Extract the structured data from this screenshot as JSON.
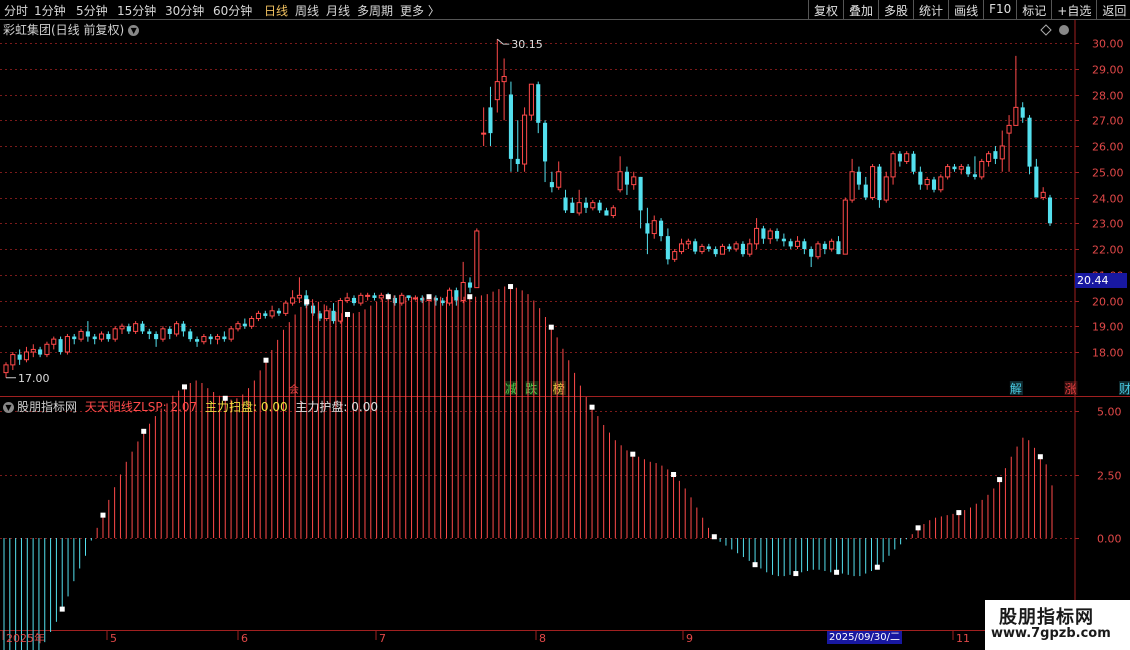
{
  "toolbar": {
    "periods": [
      "分时",
      "1分钟",
      "5分钟",
      "15分钟",
      "30分钟",
      "60分钟",
      "日线",
      "周线",
      "月线",
      "多周期",
      "更多 〉"
    ],
    "active_period": "日线",
    "buttons": [
      "复权",
      "叠加",
      "多股",
      "统计",
      "画线",
      "F10",
      "标记",
      "+自选",
      "返回"
    ]
  },
  "main_title": "彩虹集团(日线 前复权)",
  "price_tag": "20.44",
  "high_label": "30.15",
  "low_label": "17.00",
  "event_markers": [
    {
      "label": "减",
      "color": "#49c949"
    },
    {
      "label": "跌",
      "color": "#49c949"
    },
    {
      "label": "榜",
      "color": "#e0c040"
    },
    {
      "label": "解",
      "color": "#48c8e0"
    },
    {
      "label": "涨",
      "color": "#e04040"
    },
    {
      "label": "财",
      "color": "#48c8e0"
    }
  ],
  "small_marker": "会",
  "indicator_title": {
    "name": "股朋指标网",
    "line1": "天天阳线ZLSP: 2.07",
    "line2": "主力扫盘: 0.00",
    "line3": "主力护盘: 0.00"
  },
  "x_axis_labels": [
    "2025年",
    "5",
    "6",
    "7",
    "8",
    "9",
    "11"
  ],
  "date_tag": "2025/09/30/二",
  "watermark": {
    "line1": "股朋指标网",
    "line2": "www.7gpzb.com"
  },
  "colors": {
    "up": "#ff4a4a",
    "down": "#54e0ee",
    "grid": "#7a1a1a",
    "axis": "#a02020"
  },
  "chart_data": [
    {
      "type": "candlestick",
      "yticks": [
        "18.00",
        "19.00",
        "20.00",
        "21.00",
        "22.00",
        "23.00",
        "24.00",
        "25.00",
        "26.00",
        "27.00",
        "28.00",
        "29.00",
        "30.00"
      ],
      "ylim": [
        17.0,
        30.15
      ],
      "candles": [
        [
          17.2,
          17.5,
          17.0,
          17.6
        ],
        [
          17.5,
          17.9,
          17.3,
          18.0
        ],
        [
          17.9,
          17.7,
          17.5,
          18.1
        ],
        [
          17.7,
          18.0,
          17.6,
          18.2
        ],
        [
          18.0,
          18.1,
          17.8,
          18.3
        ],
        [
          18.1,
          17.9,
          17.8,
          18.2
        ],
        [
          17.9,
          18.3,
          17.8,
          18.4
        ],
        [
          18.3,
          18.5,
          18.1,
          18.6
        ],
        [
          18.5,
          18.0,
          17.9,
          18.6
        ],
        [
          18.0,
          18.6,
          17.9,
          18.7
        ],
        [
          18.6,
          18.5,
          18.3,
          18.7
        ],
        [
          18.5,
          18.8,
          18.4,
          18.9
        ],
        [
          18.8,
          18.6,
          18.4,
          19.2
        ],
        [
          18.6,
          18.5,
          18.3,
          18.7
        ],
        [
          18.5,
          18.7,
          18.4,
          18.8
        ],
        [
          18.7,
          18.5,
          18.4,
          18.8
        ],
        [
          18.5,
          18.9,
          18.4,
          19.0
        ],
        [
          18.9,
          19.0,
          18.7,
          19.1
        ],
        [
          19.0,
          18.8,
          18.7,
          19.1
        ],
        [
          18.8,
          19.1,
          18.7,
          19.2
        ],
        [
          19.1,
          18.8,
          18.7,
          19.2
        ],
        [
          18.8,
          18.7,
          18.5,
          18.9
        ],
        [
          18.7,
          18.5,
          18.2,
          18.8
        ],
        [
          18.5,
          18.9,
          18.4,
          19.0
        ],
        [
          18.9,
          18.7,
          18.5,
          19.0
        ],
        [
          18.7,
          19.1,
          18.6,
          19.2
        ],
        [
          19.1,
          18.8,
          18.6,
          19.2
        ],
        [
          18.8,
          18.5,
          18.4,
          18.9
        ],
        [
          18.5,
          18.4,
          18.2,
          18.6
        ],
        [
          18.4,
          18.6,
          18.3,
          18.7
        ],
        [
          18.6,
          18.5,
          18.3,
          18.7
        ],
        [
          18.5,
          18.6,
          18.3,
          18.7
        ],
        [
          18.6,
          18.5,
          18.4,
          18.8
        ],
        [
          18.5,
          18.9,
          18.4,
          19.0
        ],
        [
          18.9,
          19.1,
          18.8,
          19.2
        ],
        [
          19.1,
          19.0,
          18.9,
          19.3
        ],
        [
          19.0,
          19.3,
          18.9,
          19.4
        ],
        [
          19.3,
          19.5,
          19.2,
          19.6
        ],
        [
          19.5,
          19.4,
          19.3,
          19.6
        ],
        [
          19.4,
          19.6,
          19.3,
          19.8
        ],
        [
          19.6,
          19.5,
          19.4,
          19.7
        ],
        [
          19.5,
          19.9,
          19.4,
          20.0
        ],
        [
          19.9,
          20.1,
          19.8,
          20.4
        ],
        [
          20.1,
          20.2,
          19.9,
          20.9
        ],
        [
          20.2,
          19.8,
          19.7,
          20.4
        ],
        [
          19.8,
          19.5,
          19.4,
          19.9
        ],
        [
          19.5,
          19.3,
          19.2,
          19.6
        ],
        [
          19.3,
          19.6,
          19.2,
          19.8
        ],
        [
          19.6,
          19.2,
          19.1,
          19.9
        ],
        [
          19.2,
          20.0,
          19.1,
          20.1
        ],
        [
          20.0,
          20.1,
          19.9,
          20.3
        ],
        [
          20.1,
          19.9,
          19.8,
          20.2
        ],
        [
          19.9,
          20.2,
          19.8,
          20.3
        ],
        [
          20.2,
          20.2,
          20.0,
          20.3
        ],
        [
          20.2,
          20.1,
          20.0,
          20.3
        ],
        [
          20.1,
          20.2,
          20.0,
          20.3
        ],
        [
          20.2,
          20.1,
          20.0,
          20.3
        ],
        [
          20.1,
          19.9,
          19.8,
          20.2
        ],
        [
          19.9,
          20.2,
          19.8,
          20.3
        ],
        [
          20.2,
          20.1,
          20.0,
          20.2
        ],
        [
          20.1,
          20.1,
          20.0,
          20.2
        ],
        [
          20.1,
          20.0,
          19.9,
          20.2
        ],
        [
          20.0,
          20.1,
          19.8,
          20.2
        ],
        [
          20.1,
          20.0,
          19.8,
          20.2
        ],
        [
          20.0,
          19.9,
          19.8,
          20.1
        ],
        [
          19.9,
          20.4,
          19.8,
          20.5
        ],
        [
          20.4,
          20.0,
          19.8,
          20.5
        ],
        [
          20.0,
          20.7,
          19.9,
          21.5
        ],
        [
          20.7,
          20.5,
          20.3,
          20.9
        ],
        [
          20.5,
          22.7,
          20.5,
          22.8
        ],
        [
          26.5,
          26.5,
          26.0,
          27.5
        ],
        [
          27.5,
          26.5,
          26.0,
          28.3
        ],
        [
          27.8,
          28.5,
          27.3,
          30.15
        ],
        [
          28.5,
          28.7,
          27.0,
          29.4
        ],
        [
          28.0,
          25.5,
          25.0,
          28.5
        ],
        [
          25.5,
          25.3,
          25.0,
          27.0
        ],
        [
          25.3,
          27.2,
          25.0,
          27.5
        ],
        [
          27.2,
          28.4,
          27.0,
          28.4
        ],
        [
          28.4,
          26.9,
          26.5,
          28.5
        ],
        [
          26.9,
          25.4,
          24.6,
          27.0
        ],
        [
          24.6,
          24.4,
          24.2,
          25.0
        ],
        [
          24.4,
          25.0,
          24.3,
          25.4
        ],
        [
          24.0,
          23.5,
          23.4,
          24.3
        ],
        [
          23.8,
          23.4,
          23.4,
          24.0
        ],
        [
          23.4,
          23.8,
          23.3,
          24.3
        ],
        [
          23.8,
          23.6,
          23.4,
          24.0
        ],
        [
          23.6,
          23.8,
          23.5,
          23.9
        ],
        [
          23.8,
          23.5,
          23.4,
          23.9
        ],
        [
          23.5,
          23.3,
          23.3,
          23.6
        ],
        [
          23.3,
          23.6,
          23.2,
          23.7
        ],
        [
          24.3,
          25.0,
          24.2,
          25.6
        ],
        [
          25.0,
          24.5,
          24.1,
          25.2
        ],
        [
          24.5,
          24.8,
          24.3,
          25.0
        ],
        [
          24.8,
          23.5,
          22.8,
          24.8
        ],
        [
          23.0,
          22.6,
          21.8,
          23.6
        ],
        [
          22.6,
          23.1,
          22.4,
          23.3
        ],
        [
          23.1,
          22.5,
          22.3,
          23.2
        ],
        [
          22.5,
          21.6,
          21.4,
          22.8
        ],
        [
          21.6,
          21.9,
          21.5,
          22.0
        ],
        [
          21.9,
          22.2,
          21.8,
          22.4
        ],
        [
          22.2,
          22.3,
          22.0,
          22.4
        ],
        [
          22.3,
          21.9,
          21.8,
          22.4
        ],
        [
          21.9,
          22.1,
          21.8,
          22.2
        ],
        [
          22.1,
          22.0,
          21.9,
          22.2
        ],
        [
          22.0,
          21.8,
          21.7,
          22.1
        ],
        [
          21.8,
          22.1,
          21.8,
          22.2
        ],
        [
          22.1,
          22.0,
          21.9,
          22.2
        ],
        [
          22.0,
          22.2,
          21.9,
          22.3
        ],
        [
          22.2,
          21.8,
          21.7,
          22.3
        ],
        [
          21.8,
          22.2,
          21.7,
          22.4
        ],
        [
          22.2,
          22.8,
          22.0,
          23.2
        ],
        [
          22.8,
          22.4,
          22.2,
          22.9
        ],
        [
          22.4,
          22.7,
          22.2,
          22.8
        ],
        [
          22.7,
          22.4,
          22.3,
          22.8
        ],
        [
          22.4,
          22.3,
          22.1,
          22.6
        ],
        [
          22.3,
          22.1,
          22.0,
          22.4
        ],
        [
          22.1,
          22.3,
          22.0,
          22.5
        ],
        [
          22.3,
          22.0,
          21.8,
          22.4
        ],
        [
          22.0,
          21.7,
          21.3,
          22.1
        ],
        [
          21.7,
          22.2,
          21.6,
          22.3
        ],
        [
          22.2,
          22.0,
          21.8,
          22.3
        ],
        [
          22.0,
          22.3,
          21.9,
          22.4
        ],
        [
          22.3,
          21.8,
          21.8,
          22.5
        ],
        [
          21.8,
          23.9,
          21.8,
          24.0
        ],
        [
          23.9,
          25.0,
          23.8,
          25.5
        ],
        [
          25.0,
          24.5,
          24.3,
          25.2
        ],
        [
          24.5,
          24.0,
          23.9,
          24.8
        ],
        [
          24.0,
          25.2,
          23.9,
          25.3
        ],
        [
          25.2,
          23.9,
          23.6,
          25.3
        ],
        [
          23.9,
          24.8,
          23.8,
          25.0
        ],
        [
          24.8,
          25.7,
          24.5,
          25.8
        ],
        [
          25.7,
          25.4,
          25.2,
          25.8
        ],
        [
          25.4,
          25.7,
          25.3,
          25.8
        ],
        [
          25.7,
          25.0,
          24.9,
          25.8
        ],
        [
          25.0,
          24.5,
          24.3,
          25.2
        ],
        [
          24.5,
          24.7,
          24.3,
          24.8
        ],
        [
          24.7,
          24.3,
          24.2,
          24.8
        ],
        [
          24.3,
          24.8,
          24.2,
          24.9
        ],
        [
          24.8,
          25.2,
          24.7,
          25.3
        ],
        [
          25.2,
          25.1,
          25.0,
          25.3
        ],
        [
          25.1,
          25.2,
          24.9,
          25.3
        ],
        [
          25.2,
          24.9,
          24.8,
          25.3
        ],
        [
          24.9,
          24.8,
          24.7,
          25.6
        ],
        [
          24.8,
          25.4,
          24.7,
          25.5
        ],
        [
          25.4,
          25.7,
          25.2,
          25.8
        ],
        [
          25.8,
          25.5,
          25.3,
          26.0
        ],
        [
          25.5,
          26.0,
          25.0,
          26.6
        ],
        [
          26.5,
          26.8,
          25.0,
          27.2
        ],
        [
          26.8,
          27.5,
          26.8,
          29.5
        ],
        [
          27.5,
          27.1,
          26.9,
          27.7
        ],
        [
          27.1,
          25.2,
          24.9,
          27.2
        ],
        [
          25.2,
          24.0,
          24.0,
          25.5
        ],
        [
          24.0,
          24.2,
          23.9,
          24.4
        ],
        [
          24.0,
          23.0,
          22.9,
          24.1
        ]
      ]
    },
    {
      "type": "bar",
      "name": "天天阳线ZLSP",
      "yticks": [
        "5.00",
        "2.50",
        "0.00"
      ],
      "values": [
        -5.9,
        -5.75,
        -5.55,
        -5.3,
        -5.05,
        -4.75,
        -4.45,
        -4.1,
        -3.7,
        -3.3,
        -2.8,
        -2.3,
        -1.7,
        -1.2,
        -0.7,
        -0.1,
        0.4,
        0.9,
        1.5,
        2.0,
        2.5,
        3.0,
        3.4,
        3.8,
        4.2,
        4.5,
        4.8,
        5.1,
        5.3,
        5.6,
        5.8,
        5.95,
        6.1,
        6.2,
        6.1,
        5.9,
        5.75,
        5.6,
        5.5,
        5.45,
        5.5,
        5.65,
        5.9,
        6.2,
        6.6,
        7.0,
        7.4,
        7.8,
        8.2,
        8.5,
        8.8,
        9.1,
        9.3,
        9.4,
        9.3,
        9.2,
        9.05,
        8.9,
        8.85,
        8.8,
        8.85,
        8.9,
        9.0,
        9.15,
        9.3,
        9.4,
        9.5,
        9.55,
        9.55,
        9.5,
        9.5,
        9.5,
        9.5,
        9.5,
        9.5,
        9.5,
        9.5,
        9.5,
        9.5,
        9.5,
        9.5,
        9.5,
        9.55,
        9.6,
        9.7,
        9.8,
        9.9,
        9.9,
        9.85,
        9.75,
        9.6,
        9.35,
        9.05,
        8.7,
        8.3,
        7.9,
        7.45,
        7.0,
        6.5,
        6.0,
        5.55,
        5.15,
        4.8,
        4.45,
        4.15,
        3.85,
        3.65,
        3.45,
        3.3,
        3.2,
        3.1,
        3.0,
        2.95,
        2.85,
        2.7,
        2.5,
        2.25,
        1.95,
        1.6,
        1.2,
        0.8,
        0.4,
        0.05,
        -0.15,
        -0.3,
        -0.45,
        -0.6,
        -0.75,
        -0.9,
        -1.05,
        -1.2,
        -1.35,
        -1.45,
        -1.5,
        -1.5,
        -1.45,
        -1.4,
        -1.35,
        -1.3,
        -1.25,
        -1.25,
        -1.3,
        -1.35,
        -1.35,
        -1.4,
        -1.45,
        -1.5,
        -1.5,
        -1.4,
        -1.3,
        -1.15,
        -0.95,
        -0.7,
        -0.45,
        -0.25,
        -0.05,
        0.15,
        0.4,
        0.55,
        0.7,
        0.8,
        0.85,
        0.9,
        0.95,
        1.0,
        1.1,
        1.2,
        1.35,
        1.5,
        1.7,
        1.95,
        2.3,
        2.75,
        3.2,
        3.6,
        3.95,
        3.85,
        3.55,
        3.2,
        2.9,
        2.07
      ]
    }
  ]
}
